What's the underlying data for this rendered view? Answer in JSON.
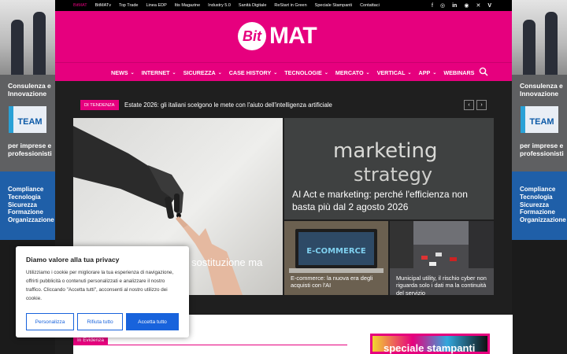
{
  "topbar": {
    "links": [
      "BitMAT",
      "BitMATv",
      "Top Trade",
      "Linea EDP",
      "Itis Magazine",
      "Industry 5.0",
      "Sanità Digitale",
      "ReStart in Green",
      "Speciale Stampanti",
      "Contattaci"
    ],
    "social_icons": [
      "facebook-icon",
      "instagram-icon",
      "linkedin-icon",
      "rss-icon",
      "x-icon",
      "vimeo-icon"
    ]
  },
  "logo": {
    "bit": "Bit",
    "mat": "MAT"
  },
  "nav": {
    "items": [
      {
        "label": "NEWS",
        "dropdown": true
      },
      {
        "label": "INTERNET",
        "dropdown": true
      },
      {
        "label": "SICUREZZA",
        "dropdown": true
      },
      {
        "label": "CASE HISTORY",
        "dropdown": true
      },
      {
        "label": "TECNOLOGIE",
        "dropdown": true
      },
      {
        "label": "MERCATO",
        "dropdown": true
      },
      {
        "label": "VERTICAL",
        "dropdown": true
      },
      {
        "label": "APP",
        "dropdown": true
      },
      {
        "label": "WEBINARS",
        "dropdown": false
      }
    ],
    "search_icon": "search-icon"
  },
  "side_banner": {
    "text1": "Consulenza e Innovazione",
    "logo": "TEAM",
    "text2": "per imprese e professionisti",
    "lines": [
      "Compliance",
      "Tecnologia",
      "Sicurezza",
      "Formazione",
      "Organizzazione"
    ]
  },
  "trending": {
    "badge": "DI TENDENZA",
    "headline": "Estate 2026: gli italiani scelgono le mete con l'aiuto dell'intelligenza artificiale"
  },
  "tiles": {
    "big": {
      "title": "sostituzione ma"
    },
    "marketing": {
      "title": "AI Act e marketing: perché l'efficienza non basta più dal 2 agosto 2026",
      "image_text": [
        "marketing",
        "strategy"
      ]
    },
    "ecommerce": {
      "title": "E-commerce: la nuova era degli acquisti con l'AI",
      "image_text": "E-COMMERCE"
    },
    "city": {
      "title": "Municipal utility, il rischio cyber non riguarda solo i dati ma la continuità del servizio"
    }
  },
  "lower": {
    "section_label": "In Evidenza",
    "sidebar_banner": "speciale stampanti"
  },
  "cookie": {
    "title": "Diamo valore alla tua privacy",
    "text": "Utilizziamo i cookie per migliorare la tua esperienza di navigazione, offrirti pubblicità o contenuti personalizzati e analizzare il nostro traffico. Cliccando \"Accetta tutti\", acconsenti al nostro utilizzo dei cookie.",
    "buttons": {
      "customize": "Personalizza",
      "reject": "Rifiuta tutto",
      "accept": "Accetta tutto"
    }
  },
  "colors": {
    "brand": "#e6007e",
    "cookie_blue": "#1863dc",
    "dark_bg": "#1f1f1f"
  }
}
